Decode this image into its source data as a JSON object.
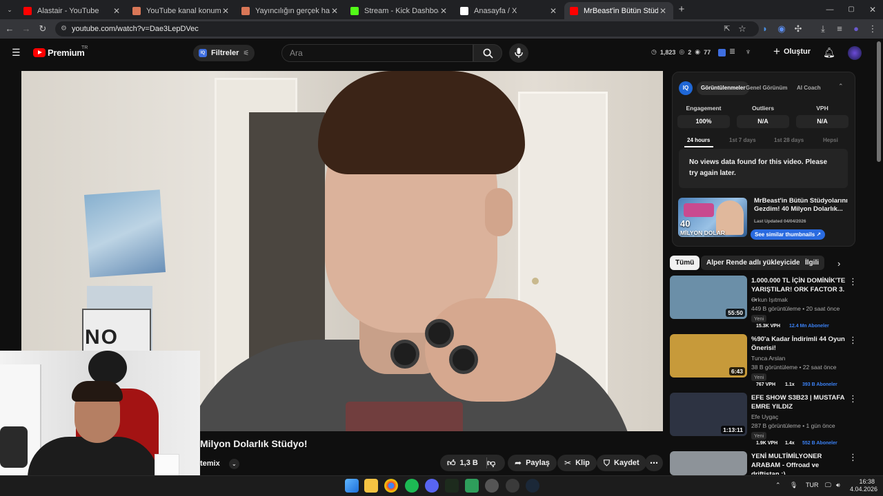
{
  "browser": {
    "tabs": [
      {
        "title": "Alastair - YouTube",
        "favicon_color": "#ff0000"
      },
      {
        "title": "YouTube kanal konumlandırma",
        "favicon_color": "#d97757"
      },
      {
        "title": "Yayıncılığın gerçek hazırlığı - Cl",
        "favicon_color": "#d97757"
      },
      {
        "title": "Stream - Kick Dashboard",
        "favicon_color": "#53fc18"
      },
      {
        "title": "Anasayfa / X",
        "favicon_color": "#ffffff"
      },
      {
        "title": "MrBeast'in Bütün Stüdyolarını G",
        "favicon_color": "#ff0000"
      }
    ],
    "url": "youtube.com/watch?v=Dae3LepDVec",
    "new_tab": "+"
  },
  "masthead": {
    "logo": "Premium",
    "country": "TR",
    "filters": "Filtreler",
    "search_placeholder": "Ara",
    "counts": {
      "views": "1,823",
      "a": "2",
      "b": "77"
    },
    "create": "Oluştur"
  },
  "video": {
    "title": "Milyon Dolarlık Stüdyo!",
    "channel": "temix",
    "sign": "NO",
    "likes": "1,3 B",
    "share": "Paylaş",
    "clip": "Klip",
    "save": "Kaydet"
  },
  "vidiq": {
    "logo": "IQ",
    "tabs": [
      "Görüntülenmeler",
      "Genel Görünüm",
      "AI Coach"
    ],
    "metrics": [
      {
        "label": "Engagement",
        "value": "100%"
      },
      {
        "label": "Outliers",
        "value": "N/A"
      },
      {
        "label": "VPH",
        "value": "N/A"
      }
    ],
    "ranges": [
      "24 hours",
      "1st 7 days",
      "1st 28 days",
      "Hepsi"
    ],
    "message": "No views data found for this video. Please try again later.",
    "card_title": "MrBeast'in Bütün Stüdyolarını Gezdim! 40 Milyon Dolarlık...",
    "thumb_text_1": "40",
    "thumb_text_2": "MİLYON DOLAR",
    "updated": "Last Updated 04/04/2026",
    "similar": "See similar thumbnails"
  },
  "chips": [
    "Tümü",
    "Alper Rende adlı yükleyiciden",
    "İlgili"
  ],
  "recommendations": [
    {
      "title": "1.000.000 TL İÇİN DOMİNİK'TE YARIŞTILAR! ORK FACTOR 3. ...",
      "channel": "Orkun Işıtmak",
      "meta": "449 B görüntüleme • 20 saat önce",
      "duration": "55:50",
      "badge": "Yeni",
      "vph": "15.3K VPH",
      "ratio": "",
      "subs": "12.4 Mn Aboneler",
      "thumb": "#6b8fa8"
    },
    {
      "title": "%90'a Kadar İndirimli 44 Oyun Önerisi!",
      "channel": "Tunca Arslan",
      "meta": "38 B görüntüleme • 22 saat önce",
      "duration": "6:43",
      "badge": "Yeni",
      "vph": "767 VPH",
      "ratio": "1.1x",
      "subs": "393 B Aboneler",
      "thumb": "#c79a3a"
    },
    {
      "title": "EFE SHOW S3B23 | MUSTAFA EMRE YILDIZ",
      "channel": "Efe Uygaç",
      "meta": "287 B görüntüleme • 1 gün önce",
      "duration": "1:13:11",
      "badge": "Yeni",
      "vph": "1.9K VPH",
      "ratio": "1.4x",
      "subs": "552 B Aboneler",
      "thumb": "#2d3342"
    },
    {
      "title": "YENİ MULTİMİLYONER ARABAM - Offroad ve driftistan ;)",
      "channel": "",
      "meta": "",
      "duration": "",
      "badge": "",
      "vph": "",
      "ratio": "",
      "subs": "",
      "thumb": "#8d9399"
    }
  ],
  "taskbar": {
    "lang": "TUR",
    "time": "16:38",
    "date": "4.04.2026"
  }
}
